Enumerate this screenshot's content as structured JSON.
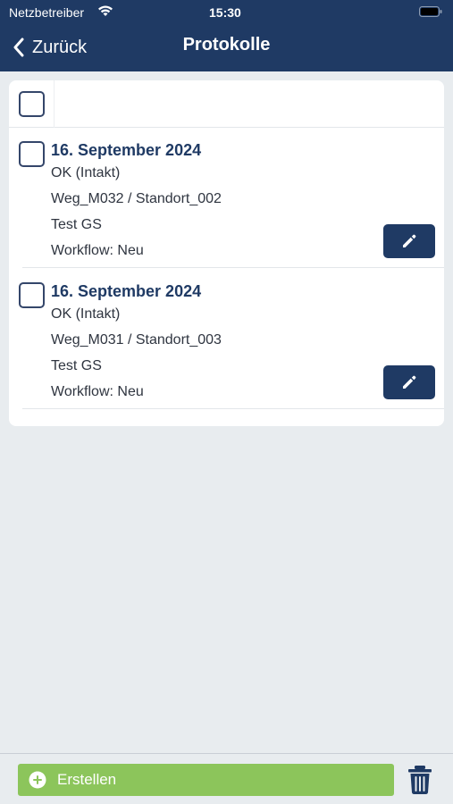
{
  "status_bar": {
    "carrier": "Netzbetreiber",
    "time": "15:30",
    "wifi_icon": "wifi-icon",
    "battery_icon": "battery-icon"
  },
  "nav": {
    "back_label": "Zurück",
    "title": "Protokolle"
  },
  "entries": [
    {
      "date": "16. September 2024",
      "status": "OK (Intakt)",
      "location": "Weg_M032 / Standort_002",
      "name": "Test GS",
      "workflow": "Workflow: Neu",
      "checked": false
    },
    {
      "date": "16. September 2024",
      "status": "OK (Intakt)",
      "location": "Weg_M031 / Standort_003",
      "name": "Test GS",
      "workflow": "Workflow: Neu",
      "checked": false
    }
  ],
  "footer": {
    "create_label": "Erstellen",
    "create_icon": "plus-circle-icon",
    "delete_icon": "trash-icon"
  },
  "colors": {
    "navy": "#1f3a64",
    "green": "#8cc55b",
    "background": "#e8ecef"
  }
}
